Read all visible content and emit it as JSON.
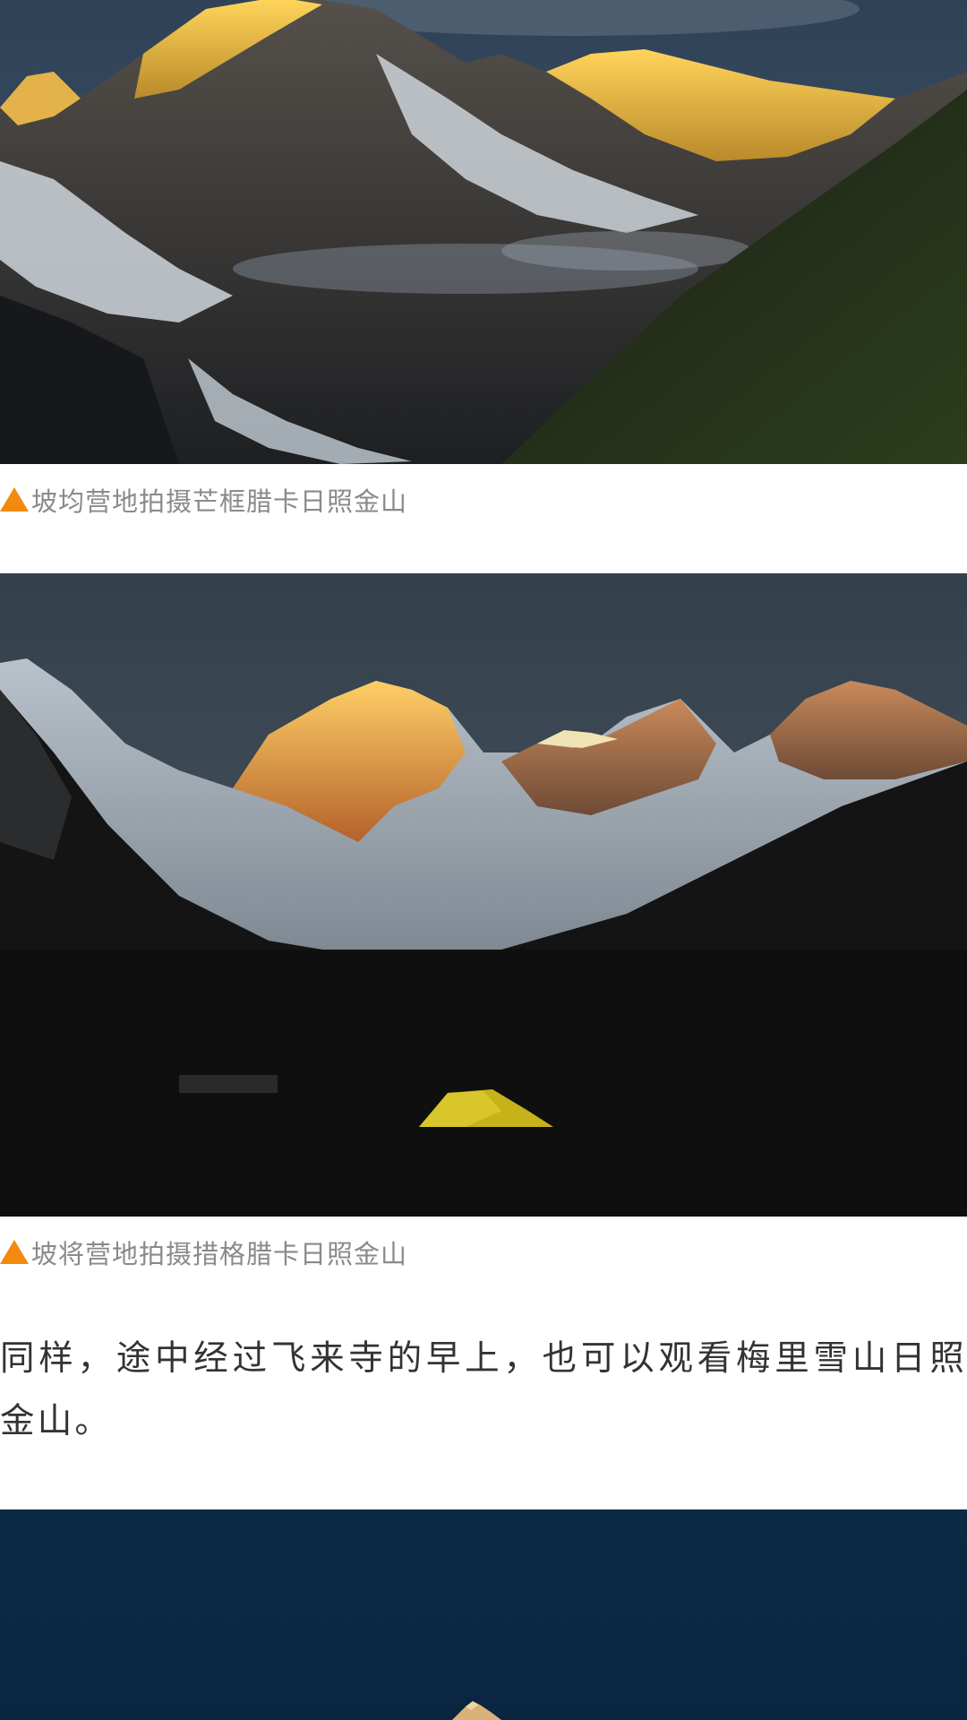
{
  "captions": {
    "first": "坡均营地拍摄芒框腊卡日照金山",
    "second": "坡将营地拍摄措格腊卡日照金山"
  },
  "paragraph": "同样，途中经过飞来寺的早上，也可以观看梅里雪山日照金山。",
  "icons": {
    "caption_marker": "orange-triangle-icon"
  },
  "colors": {
    "caption_marker": "#f28a10",
    "caption_text": "#8a8a8a",
    "body_text": "#333333",
    "background": "#ffffff"
  }
}
